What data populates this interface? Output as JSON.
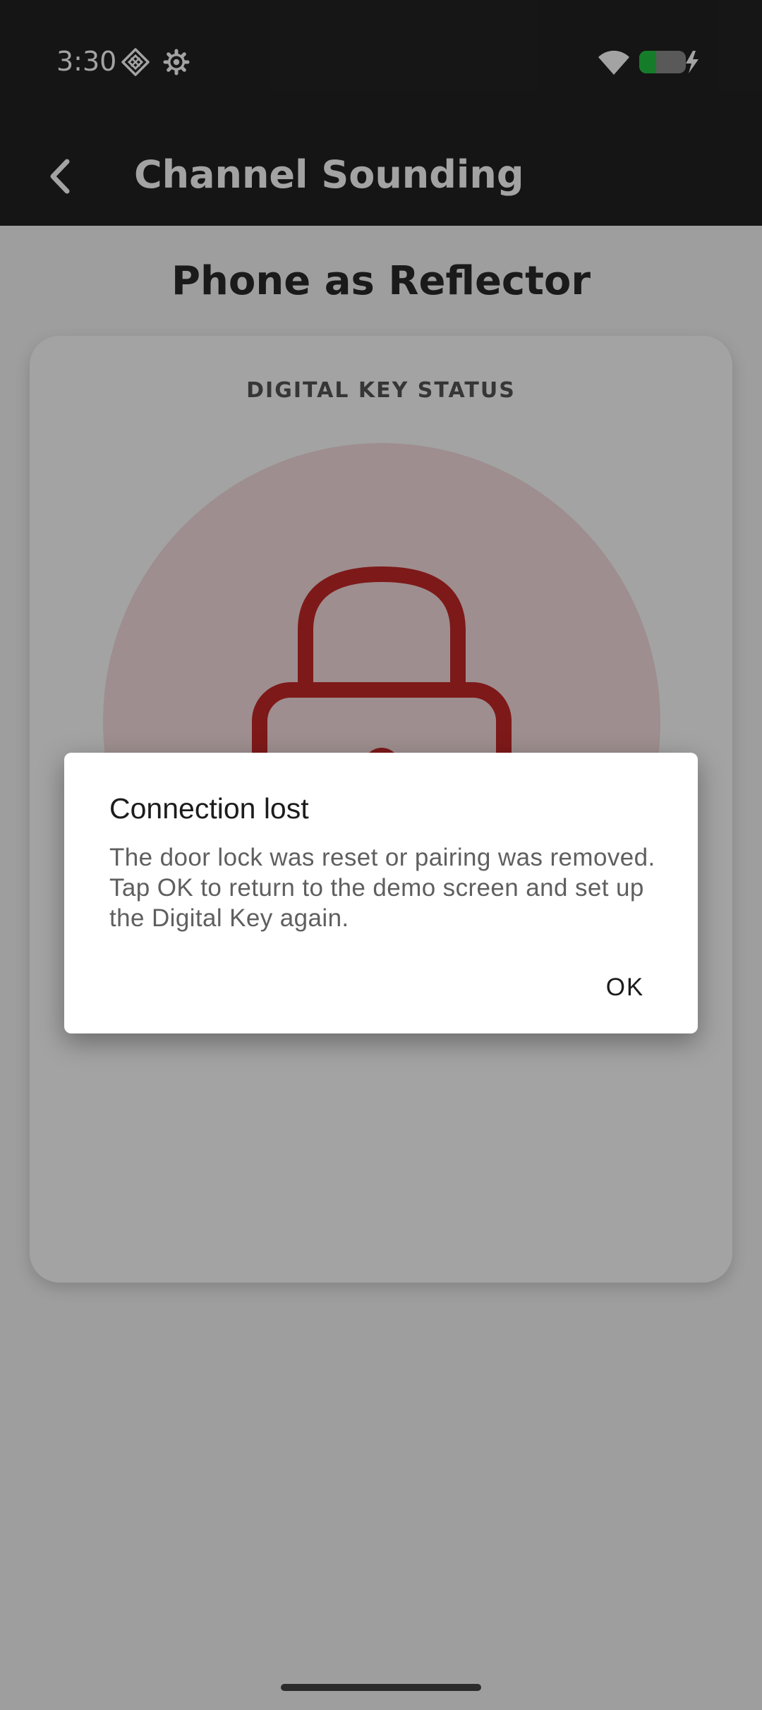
{
  "status_bar": {
    "time": "3:30",
    "icons": [
      "nearby-share-icon",
      "settings-icon",
      "wifi-icon",
      "battery-charging-icon"
    ],
    "battery_color": "#22c443"
  },
  "app_bar": {
    "back_icon": "chevron-left-icon",
    "title": "Channel Sounding"
  },
  "page": {
    "heading": "Phone as Reflector",
    "card": {
      "label": "DIGITAL KEY STATUS",
      "lock_icon": "lock-icon",
      "lock_color": "#c62828",
      "circle_color": "#f8dee0"
    }
  },
  "dialog": {
    "title": "Connection lost",
    "message": "The door lock was reset or pairing was removed. Tap OK to return to the demo screen and set up the Digital Key again.",
    "ok_label": "OK"
  }
}
